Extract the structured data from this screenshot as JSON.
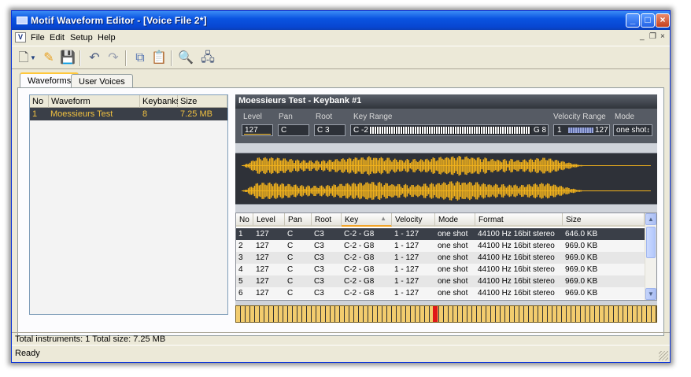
{
  "window": {
    "title": "Motif Waveform Editor - [Voice File 2*]"
  },
  "menu": {
    "items": [
      "File",
      "Edit",
      "Setup",
      "Help"
    ],
    "app_icon_letter": "V"
  },
  "toolbar": {
    "icons": [
      "new-file-icon",
      "dropdown-arrow-icon",
      "open-icon",
      "save-icon",
      "undo-icon",
      "redo-icon",
      "copy-icon",
      "paste-icon",
      "search-icon",
      "device-icon"
    ]
  },
  "tabs": [
    {
      "label": "Waveforms",
      "active": true
    },
    {
      "label": "User Voices",
      "active": false
    }
  ],
  "waveform_list": {
    "headers": [
      "No",
      "Waveform",
      "Keybanks",
      "Size"
    ],
    "rows": [
      {
        "no": "1",
        "waveform": "Moessieurs Test",
        "keybanks": "8",
        "size": "7.25 MB"
      }
    ]
  },
  "keybank": {
    "title": "Moessieurs Test - Keybank #1",
    "labels": {
      "level": "Level",
      "pan": "Pan",
      "root": "Root",
      "key_range": "Key Range",
      "velocity_range": "Velocity Range",
      "mode": "Mode"
    },
    "values": {
      "level": "127",
      "pan": "C",
      "root": "C 3",
      "key_low": "C -2",
      "key_high": "G 8",
      "vel_low": "1",
      "vel_high": "127",
      "mode": "one shot"
    }
  },
  "keybank_table": {
    "headers": [
      "No",
      "Level",
      "Pan",
      "Root",
      "Key",
      "Velocity",
      "Mode",
      "Format",
      "Size"
    ],
    "sorted_column": "Key",
    "rows": [
      {
        "no": "1",
        "level": "127",
        "pan": "C",
        "root": "C3",
        "key": "C-2 - G8",
        "velocity": "1 - 127",
        "mode": "one shot",
        "format": "44100 Hz  16bit  stereo",
        "size": "646.0 KB"
      },
      {
        "no": "2",
        "level": "127",
        "pan": "C",
        "root": "C3",
        "key": "C-2 - G8",
        "velocity": "1 - 127",
        "mode": "one shot",
        "format": "44100 Hz  16bit  stereo",
        "size": "969.0 KB"
      },
      {
        "no": "3",
        "level": "127",
        "pan": "C",
        "root": "C3",
        "key": "C-2 - G8",
        "velocity": "1 - 127",
        "mode": "one shot",
        "format": "44100 Hz  16bit  stereo",
        "size": "969.0 KB"
      },
      {
        "no": "4",
        "level": "127",
        "pan": "C",
        "root": "C3",
        "key": "C-2 - G8",
        "velocity": "1 - 127",
        "mode": "one shot",
        "format": "44100 Hz  16bit  stereo",
        "size": "969.0 KB"
      },
      {
        "no": "5",
        "level": "127",
        "pan": "C",
        "root": "C3",
        "key": "C-2 - G8",
        "velocity": "1 - 127",
        "mode": "one shot",
        "format": "44100 Hz  16bit  stereo",
        "size": "969.0 KB"
      },
      {
        "no": "6",
        "level": "127",
        "pan": "C",
        "root": "C3",
        "key": "C-2 - G8",
        "velocity": "1 - 127",
        "mode": "one shot",
        "format": "44100 Hz  16bit  stereo",
        "size": "969.0 KB"
      }
    ]
  },
  "status": {
    "info": "Total instruments: 1   Total size: 7.25 MB",
    "text": "Ready"
  },
  "colors": {
    "accent": "#ffc83c",
    "waveform": "#f2b21c",
    "key_marker": "#e01818",
    "titlebar": "#0a54e1"
  }
}
